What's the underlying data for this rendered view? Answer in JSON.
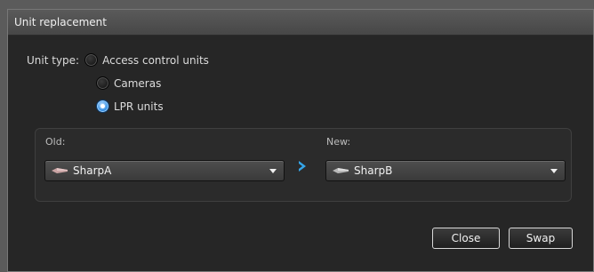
{
  "window": {
    "title": "Unit replacement"
  },
  "unit_type": {
    "label": "Unit type:",
    "options": [
      {
        "label": "Access control units",
        "selected": false
      },
      {
        "label": "Cameras",
        "selected": false
      },
      {
        "label": "LPR units",
        "selected": true
      }
    ]
  },
  "swap_panel": {
    "old_label": "Old:",
    "new_label": "New:",
    "old_value": "SharpA",
    "new_value": "SharpB",
    "old_icon": "lpr-unit-icon",
    "new_icon": "lpr-unit-icon",
    "arrow_icon": "chevron-right-icon"
  },
  "buttons": {
    "close": "Close",
    "swap": "Swap"
  },
  "colors": {
    "accent": "#3a93e6",
    "background": "#262626",
    "titlebar": "#4f4f4f"
  }
}
